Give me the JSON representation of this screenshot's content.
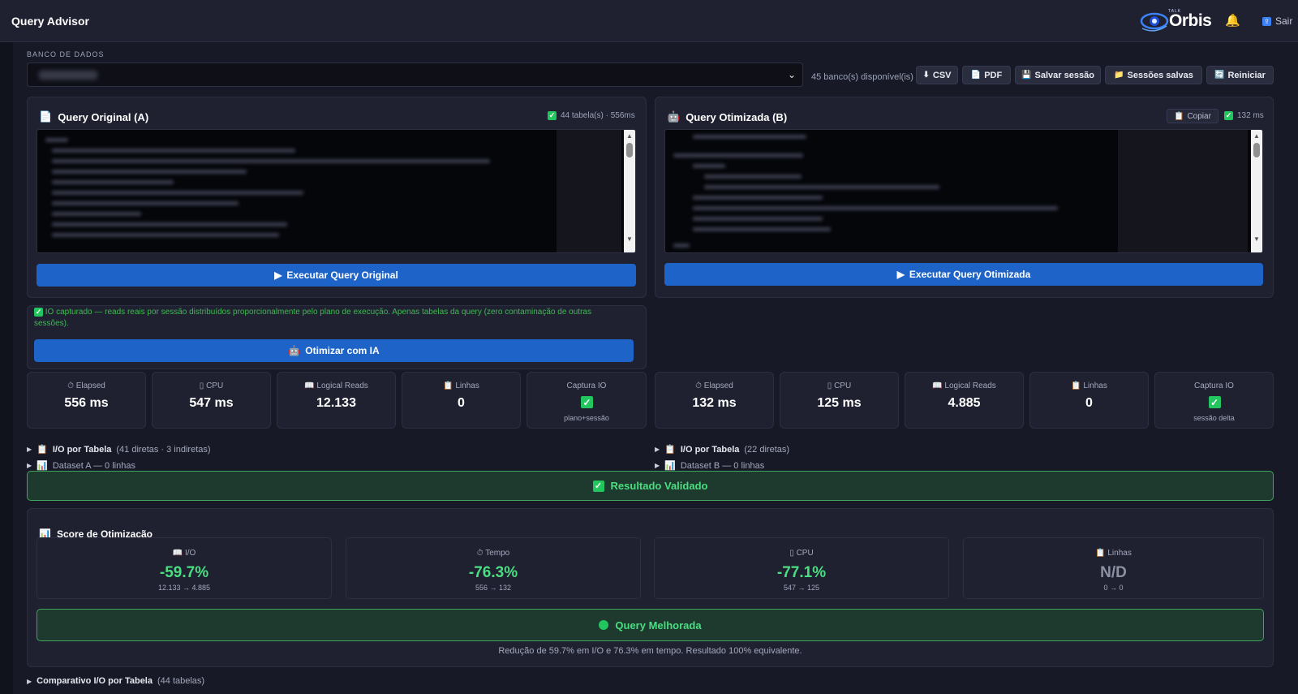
{
  "app": {
    "title": "Query Advisor"
  },
  "brand": {
    "small": "TALK",
    "name": "Orbis"
  },
  "header": {
    "logout_label": "Sair"
  },
  "database": {
    "label": "BANCO DE DADOS",
    "available": "45 banco(s) disponível(is)"
  },
  "toolbar": {
    "csv": "CSV",
    "pdf": "PDF",
    "save_session": "Salvar sessão",
    "saved_sessions": "Sessões salvas",
    "restart": "Reiniciar"
  },
  "query_a": {
    "title": "Query Original (A)",
    "meta": "44 tabela(s) · 556ms",
    "run_label": "Executar Query Original"
  },
  "query_b": {
    "title": "Query Otimizada (B)",
    "copy_label": "Copiar",
    "meta": "132 ms",
    "run_label": "Executar Query Otimizada"
  },
  "io_note": "IO capturado — reads reais por sessão distribuídos proporcionalmente pelo plano de execução. Apenas tabelas da query (zero contaminação de outras sessões).",
  "optimize_label": "Otimizar com IA",
  "metrics_a": {
    "elapsed": {
      "label": "Elapsed",
      "value": "556 ms"
    },
    "cpu": {
      "label": "CPU",
      "value": "547 ms"
    },
    "logical_reads": {
      "label": "Logical Reads",
      "value": "12.133"
    },
    "rows": {
      "label": "Linhas",
      "value": "0"
    },
    "io_capture": {
      "label": "Captura IO",
      "sub": "plano+sessão"
    }
  },
  "metrics_b": {
    "elapsed": {
      "label": "Elapsed",
      "value": "132 ms"
    },
    "cpu": {
      "label": "CPU",
      "value": "125 ms"
    },
    "logical_reads": {
      "label": "Logical Reads",
      "value": "4.885"
    },
    "rows": {
      "label": "Linhas",
      "value": "0"
    },
    "io_capture": {
      "label": "Captura IO",
      "sub": "sessão delta"
    }
  },
  "expanders_a": {
    "io_title": "I/O por Tabela",
    "io_sub": "(41 diretas · 3 indiretas)",
    "dataset": "Dataset A — 0 linhas"
  },
  "expanders_b": {
    "io_title": "I/O por Tabela",
    "io_sub": "(22 diretas)",
    "dataset": "Dataset B — 0 linhas"
  },
  "validated_label": "Resultado Validado",
  "score": {
    "title": "Score de Otimização",
    "io": {
      "label": "I/O",
      "value": "-59.7%",
      "sub": "12.133 → 4.885"
    },
    "time": {
      "label": "Tempo",
      "value": "-76.3%",
      "sub": "556 → 132"
    },
    "cpu": {
      "label": "CPU",
      "value": "-77.1%",
      "sub": "547 → 125"
    },
    "rows": {
      "label": "Linhas",
      "value": "N/D",
      "sub": "0 → 0"
    },
    "verdict": "Query Melhorada",
    "summary": "Redução de 59.7% em I/O e 76.3% em tempo. Resultado 100% equivalente."
  },
  "bottom_expander": {
    "title": "Comparativo I/O por Tabela",
    "sub": "(44 tabelas)"
  },
  "colors": {
    "accent": "#1e64c8",
    "success": "#4ade80",
    "background": "#171926",
    "panel": "#1f2131"
  }
}
